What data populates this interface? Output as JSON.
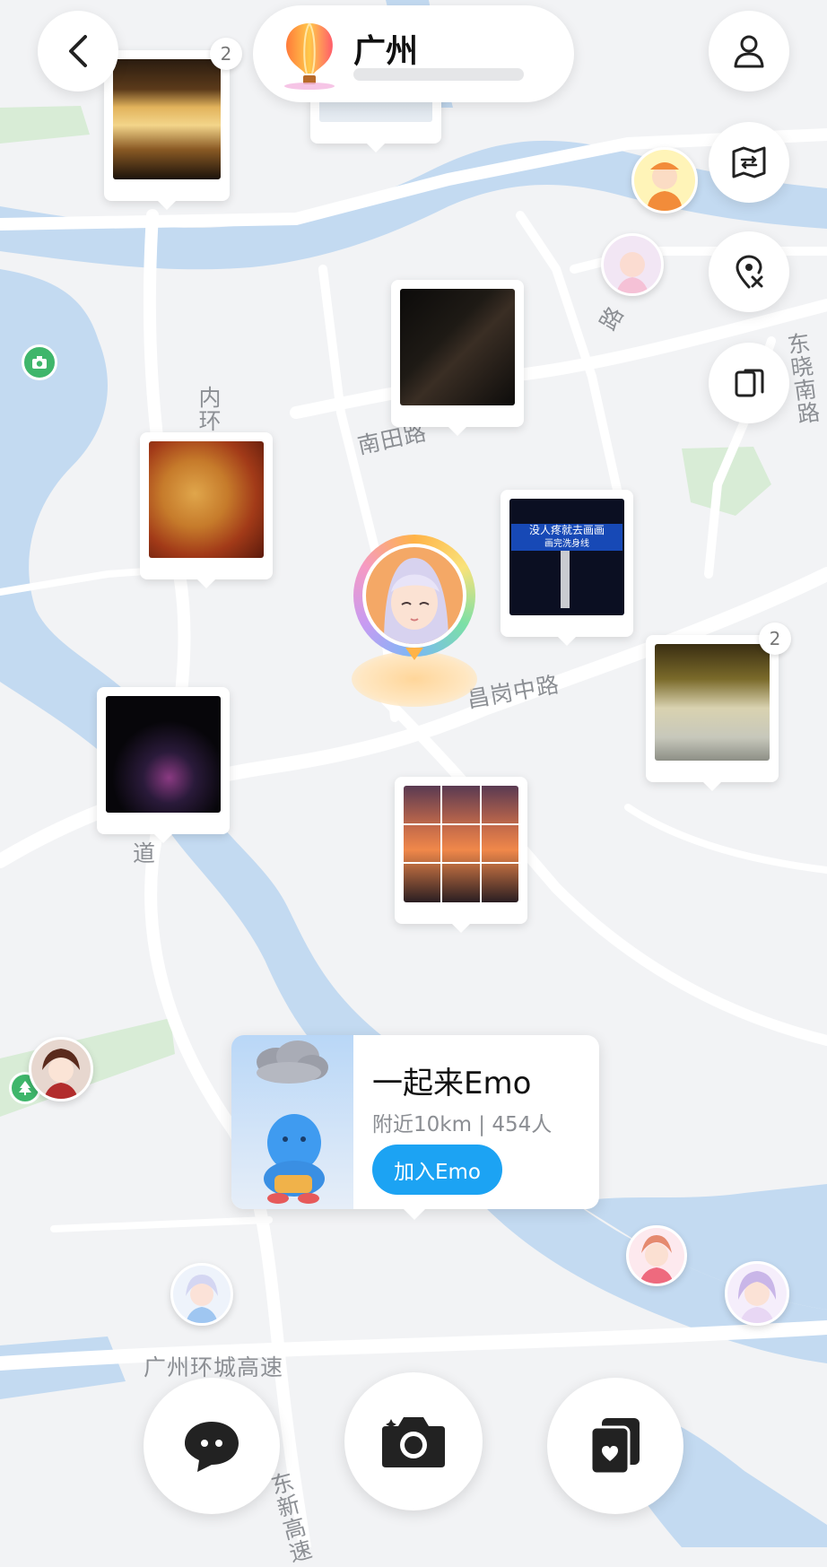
{
  "header": {
    "city": "广州"
  },
  "map": {
    "road_labels": [
      "南田路",
      "昌岗中路",
      "广州环城高速",
      "内环",
      "东晓南路",
      "东新高速",
      "道",
      "路"
    ]
  },
  "photo_pins": [
    {
      "id": "pin1",
      "count": "2"
    },
    {
      "id": "pin2",
      "count": ""
    },
    {
      "id": "pin3",
      "count": ""
    },
    {
      "id": "pin4",
      "count": ""
    },
    {
      "id": "pin5",
      "count": ""
    },
    {
      "id": "pin6",
      "count": "2"
    },
    {
      "id": "pin7",
      "count": ""
    },
    {
      "id": "pin8",
      "count": ""
    }
  ],
  "sign_photo_text": {
    "line1": "没人疼就去画画",
    "line2": "画完洗身线"
  },
  "group_card": {
    "title": "一起来Emo",
    "meta": "附近10km | 454人",
    "join_label": "加入Emo"
  },
  "icons": {
    "back": "chevron-left-icon",
    "profile": "person-icon",
    "map_switch": "map-icon",
    "location_off": "location-off-icon",
    "cards": "cards-icon",
    "chat": "chat-bubble-icon",
    "camera": "camera-icon",
    "cards_heart": "cards-heart-icon"
  },
  "colors": {
    "accent": "#1ca3f3",
    "water": "#c3daf1",
    "park": "#d8ecd6",
    "road": "#ffffff"
  }
}
